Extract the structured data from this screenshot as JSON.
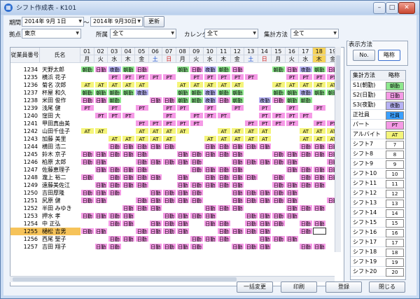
{
  "window": {
    "title": "シフト作成表 - K101",
    "icon": "calendar-icon"
  },
  "filters": {
    "period_label": "期間",
    "period_from": "2014年 9月 1日",
    "tilde": "～",
    "period_to": "2014年 9月30日",
    "update_button": "更新",
    "site_label": "拠点",
    "site_value": "東京",
    "dept_label": "所属",
    "dept_value": "全て",
    "calendar_label": "カレンダ",
    "calendar_value": "全て",
    "method_label": "集計方法",
    "method_value": "全て"
  },
  "display": {
    "label": "表示方法",
    "no_button": "No.",
    "abbr_button": "略称"
  },
  "grid": {
    "header_emp_no": "従業員番号",
    "header_name": "氏名",
    "days": [
      "01",
      "02",
      "03",
      "04",
      "05",
      "06",
      "07",
      "08",
      "09",
      "10",
      "11",
      "12",
      "13",
      "14",
      "15",
      "16",
      "17",
      "18",
      "19"
    ],
    "weekdays": [
      "月",
      "火",
      "水",
      "木",
      "金",
      "土",
      "日",
      "月",
      "火",
      "水",
      "木",
      "金",
      "土",
      "日",
      "月",
      "火",
      "水",
      "木",
      "金"
    ],
    "rows": [
      {
        "no": "1234",
        "name": "天野太郎",
        "cells": [
          "S1",
          "S2",
          "S3",
          "S1",
          "S2",
          "",
          "",
          "S1",
          "S2",
          "S3",
          "S1",
          "S2",
          "",
          "",
          "S1",
          "S2",
          "S3",
          "S1",
          "S2"
        ]
      },
      {
        "no": "1235",
        "name": "横浜 花子",
        "cells": [
          "",
          "",
          "PT",
          "PT",
          "PT",
          "PT",
          "PT",
          "",
          "PT",
          "PT",
          "PT",
          "PT",
          "PT",
          "",
          "",
          "PT",
          "PT",
          "PT",
          "PT"
        ]
      },
      {
        "no": "1236",
        "name": "菊名 次郎",
        "cells": [
          "AT",
          "AT",
          "AT",
          "AT",
          "AT",
          "",
          "",
          "AT",
          "AT",
          "AT",
          "AT",
          "AT",
          "",
          "",
          "AT",
          "AT",
          "AT",
          "AT",
          "AT"
        ]
      },
      {
        "no": "1237",
        "name": "杯屋 和久",
        "cells": [
          "S1",
          "S1",
          "S1",
          "S1",
          "S3",
          "",
          "",
          "S1",
          "S1",
          "S3",
          "S1",
          "S1",
          "",
          "",
          "S1",
          "S1",
          "S3",
          "S1",
          "S1"
        ]
      },
      {
        "no": "1238",
        "name": "米田 俊作",
        "cells": [
          "S2",
          "S2",
          "S1",
          "",
          "",
          "S2",
          "S2",
          "S1",
          "S1",
          "S3",
          "S2",
          "S1",
          "",
          "S3",
          "S2",
          "S1",
          "S1",
          "",
          ""
        ]
      },
      {
        "no": "1239",
        "name": "浅尾 健",
        "cells": [
          "PT",
          "",
          "PT",
          "",
          "PT",
          "",
          "PT",
          "PT",
          "",
          "PT",
          "",
          "PT",
          "",
          "PT",
          "",
          "PT",
          "",
          "PT",
          ""
        ]
      },
      {
        "no": "1240",
        "name": "窪田 大",
        "cells": [
          "",
          "PT",
          "PT",
          "PT",
          "",
          "",
          "PT",
          "",
          "PT",
          "PT",
          "PT",
          "",
          "",
          "PT",
          "PT",
          "PT",
          "PT",
          "",
          ""
        ]
      },
      {
        "no": "1241",
        "name": "甲田真由美",
        "cells": [
          "",
          "",
          "",
          "",
          "PT",
          "PT",
          "PT",
          "PT",
          "PT",
          "",
          "",
          "",
          "PT",
          "PT",
          "PT",
          "PT",
          "",
          "PT",
          "PT"
        ]
      },
      {
        "no": "1242",
        "name": "山田千佳子",
        "cells": [
          "AT",
          "AT",
          "",
          "",
          "AT",
          "AT",
          "AT",
          "AT",
          "",
          "",
          "AT",
          "AT",
          "AT",
          "AT",
          "",
          "",
          "AT",
          "AT",
          "AT"
        ]
      },
      {
        "no": "1243",
        "name": "加藤 美里",
        "cells": [
          "",
          "",
          "AT",
          "AT",
          "AT",
          "AT",
          "AT",
          "",
          "",
          "AT",
          "AT",
          "AT",
          "AT",
          "AT",
          "",
          "",
          "AT",
          "AT",
          "AT"
        ]
      },
      {
        "no": "1244",
        "name": "横田 浩二",
        "cells": [
          "",
          "",
          "S2",
          "S2",
          "S2",
          "S2",
          "S2",
          "",
          "",
          "S2",
          "S2",
          "S2",
          "S2",
          "S2",
          "",
          "",
          "S2",
          "S2",
          "S2"
        ]
      },
      {
        "no": "1245",
        "name": "鈴木 京子",
        "cells": [
          "S2",
          "S2",
          "S2",
          "S2",
          "S2",
          "",
          "",
          "S2",
          "S2",
          "S2",
          "S2",
          "S2",
          "",
          "",
          "S2",
          "S2",
          "S2",
          "S2",
          "S2"
        ]
      },
      {
        "no": "1246",
        "name": "柏原 太郎",
        "cells": [
          "S2",
          "S2",
          "",
          "",
          "S2",
          "S2",
          "S2",
          "S2",
          "S2",
          "",
          "",
          "S2",
          "S2",
          "S2",
          "S2",
          "S2",
          "",
          "",
          "S2"
        ]
      },
      {
        "no": "1247",
        "name": "佐藤恵理子",
        "cells": [
          "",
          "S2",
          "S2",
          "S2",
          "S2",
          "",
          "",
          "",
          "S2",
          "S2",
          "S2",
          "S2",
          "",
          "",
          "",
          "S2",
          "S2",
          "S2",
          "S2"
        ]
      },
      {
        "no": "1248",
        "name": "瀧上 裕二",
        "cells": [
          "S2",
          "",
          "S2",
          "S2",
          "S2",
          "S2",
          "",
          "S2",
          "",
          "S2",
          "S2",
          "S2",
          "S2",
          "",
          "S2",
          "",
          "S2",
          "S2",
          "S2"
        ]
      },
      {
        "no": "1249",
        "name": "遠藤美佐江",
        "cells": [
          "",
          "S2",
          "S2",
          "S2",
          "S2",
          "",
          "",
          "S2",
          "S2",
          "S2",
          "S2",
          "S2",
          "",
          "",
          "S2",
          "S2",
          "S2",
          "S2",
          ""
        ]
      },
      {
        "no": "1250",
        "name": "吉田厚隆",
        "cells": [
          "S2",
          "S2",
          "S2",
          "",
          "",
          "S2",
          "S2",
          "S2",
          "S2",
          "",
          "",
          "S2",
          "S2",
          "S2",
          "S2",
          "S2",
          "",
          "",
          ""
        ]
      },
      {
        "no": "1251",
        "name": "尻原 健",
        "cells": [
          "S2",
          "S2",
          "",
          "",
          "S2",
          "S2",
          "S2",
          "S2",
          "S2",
          "",
          "",
          "S2",
          "S2",
          "S2",
          "S2",
          "S2",
          "",
          "",
          "S2"
        ]
      },
      {
        "no": "1252",
        "name": "半田 みゆき",
        "cells": [
          "",
          "",
          "",
          "S2",
          "S2",
          "S2",
          "",
          "",
          "",
          "S2",
          "S2",
          "S2",
          "",
          "",
          "",
          "S2",
          "S2",
          "S2",
          ""
        ]
      },
      {
        "no": "1253",
        "name": "押水 孝",
        "cells": [
          "S2",
          "S2",
          "S2",
          "S2",
          "",
          "",
          "S2",
          "S2",
          "S2",
          "S2",
          "",
          "",
          "S2",
          "S2",
          "S2",
          "S2",
          "",
          "",
          ""
        ]
      },
      {
        "no": "1254",
        "name": "中 正弘",
        "cells": [
          "",
          "",
          "S2",
          "S2",
          "",
          "S2",
          "S2",
          "S2",
          "",
          "S2",
          "S2",
          "",
          "S2",
          "S2",
          "S2",
          "",
          "S2",
          "S2",
          ""
        ]
      },
      {
        "no": "1255",
        "name": "樋松 吉男",
        "cells": [
          "S2",
          "S2",
          "",
          "",
          "S2",
          "S2",
          "S2",
          "S2",
          "",
          "",
          "S2",
          "S2",
          "S2",
          "S2",
          "",
          "",
          "S2",
          "SEL",
          ""
        ]
      },
      {
        "no": "1256",
        "name": "西尾 聖子",
        "cells": [
          "",
          "",
          "S2",
          "S2",
          "S2",
          "",
          "",
          "",
          "S2",
          "S2",
          "S2",
          "",
          "",
          "S2",
          "S2",
          "S2",
          "",
          "",
          ""
        ]
      },
      {
        "no": "1257",
        "name": "吉田 翔子",
        "cells": [
          "",
          "S2",
          "S2",
          "",
          "",
          "S2",
          "S2",
          "S2",
          "S2",
          "",
          "",
          "S2",
          "S2",
          "S2",
          "",
          "",
          "S2",
          "S2",
          ""
        ]
      }
    ]
  },
  "codes": {
    "S1": {
      "text": "朝勤",
      "bg": "#8ee88e"
    },
    "S2": {
      "text": "日勤",
      "bg": "#f59ae6"
    },
    "S3": {
      "text": "夜勤",
      "bg": "#b6b2f4"
    },
    "PT": {
      "text": "PT",
      "bg": "#f59ae6"
    },
    "AT": {
      "text": "AT",
      "bg": "#f4f47a"
    },
    "SEL": {
      "text": "",
      "bg": "#ffffff"
    }
  },
  "summary": {
    "header_method": "集計方法",
    "header_abbr": "略称",
    "rows": [
      {
        "name": "S1(朝勤)",
        "abbr": "朝勤",
        "color": "#8ee88e"
      },
      {
        "name": "S2(日勤)",
        "abbr": "日勤",
        "color": "#f59ae6"
      },
      {
        "name": "S3(夜勤)",
        "abbr": "夜勤",
        "color": "#b6b2f4"
      },
      {
        "name": "正社員",
        "abbr": "社員",
        "color": "#3aa0ff"
      },
      {
        "name": "パート",
        "abbr": "PT",
        "color": "#f59ae6"
      },
      {
        "name": "アルバイト",
        "abbr": "AT",
        "color": "#f4f47a"
      },
      {
        "name": "シフト7",
        "abbr": "7",
        "color": "#ffffff"
      },
      {
        "name": "シフト8",
        "abbr": "8",
        "color": "#ffffff"
      },
      {
        "name": "シフト9",
        "abbr": "9",
        "color": "#ffffff"
      },
      {
        "name": "シフト10",
        "abbr": "10",
        "color": "#ffffff"
      },
      {
        "name": "シフト11",
        "abbr": "11",
        "color": "#ffffff"
      },
      {
        "name": "シフト12",
        "abbr": "12",
        "color": "#ffffff"
      },
      {
        "name": "シフト13",
        "abbr": "13",
        "color": "#ffffff"
      },
      {
        "name": "シフト14",
        "abbr": "14",
        "color": "#ffffff"
      },
      {
        "name": "シフト15",
        "abbr": "15",
        "color": "#ffffff"
      },
      {
        "name": "シフト16",
        "abbr": "16",
        "color": "#ffffff"
      },
      {
        "name": "シフト17",
        "abbr": "17",
        "color": "#ffffff"
      },
      {
        "name": "シフト18",
        "abbr": "18",
        "color": "#ffffff"
      },
      {
        "name": "シフト19",
        "abbr": "19",
        "color": "#ffffff"
      },
      {
        "name": "シフト20",
        "abbr": "20",
        "color": "#ffffff"
      }
    ]
  },
  "footer": {
    "bulk_change": "一括変更",
    "print": "印刷",
    "register": "登録",
    "close": "閉じる"
  }
}
